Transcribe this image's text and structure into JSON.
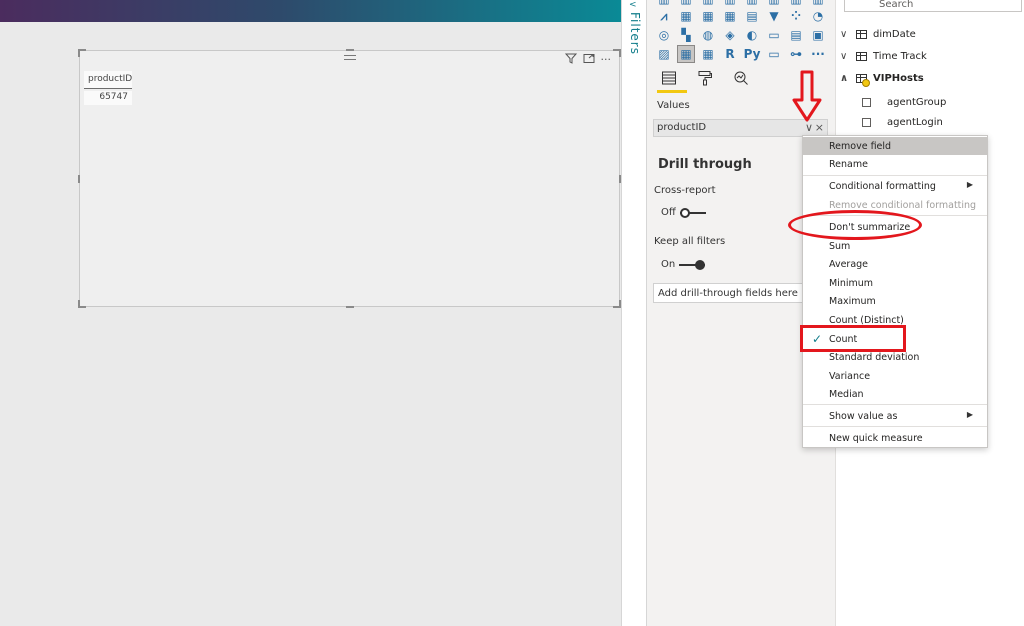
{
  "visual": {
    "table_header": "productID",
    "table_value": "65747"
  },
  "filters": {
    "label": "Filters"
  },
  "viz": {
    "rows": [
      [
        "area-chart-icon",
        "stacked-area-icon",
        "line-column-icon",
        "ribbon-icon",
        "waterfall-icon",
        "funnel-icon",
        "scatter-icon",
        "pie-icon"
      ],
      [
        "donut-icon",
        "treemap-icon",
        "map-icon",
        "filled-map-icon",
        "shape-map-icon",
        "gauge-icon",
        "card-icon",
        "multi-row-card-icon"
      ],
      [
        "kpi-icon",
        "table-icon",
        "matrix-icon",
        "r-visual-icon",
        "python-visual-icon",
        "key-influencers-icon",
        "decomposition-tree-icon",
        "more-visuals-icon"
      ]
    ],
    "r_label": "R",
    "py_label": "Py",
    "more_label": "···",
    "values_label": "Values",
    "field_name": "productID",
    "drill_title": "Drill through",
    "cross_report_label": "Cross-report",
    "cross_report_state": "Off",
    "keep_filters_label": "Keep all filters",
    "keep_filters_state": "On",
    "drill_placeholder": "Add drill-through fields here"
  },
  "fields": {
    "search_placeholder": "Search",
    "tables": [
      {
        "name": "dimDate"
      },
      {
        "name": "Time Track"
      },
      {
        "name": "VIPHosts"
      }
    ],
    "columns": [
      {
        "name": "agentGroup"
      },
      {
        "name": "agentLogin"
      }
    ]
  },
  "context_menu": {
    "items": [
      {
        "label": "Remove field"
      },
      {
        "label": "Rename"
      },
      {
        "label": "Conditional formatting"
      },
      {
        "label": "Remove conditional formatting"
      },
      {
        "label": "Don't summarize"
      },
      {
        "label": "Sum"
      },
      {
        "label": "Average"
      },
      {
        "label": "Minimum"
      },
      {
        "label": "Maximum"
      },
      {
        "label": "Count (Distinct)"
      },
      {
        "label": "Count"
      },
      {
        "label": "Standard deviation"
      },
      {
        "label": "Variance"
      },
      {
        "label": "Median"
      },
      {
        "label": "Show value as"
      },
      {
        "label": "New quick measure"
      }
    ]
  },
  "colors": {
    "accent": "#117d8b",
    "annotation_red": "#e3171d",
    "selected_tab": "#f2c811"
  }
}
